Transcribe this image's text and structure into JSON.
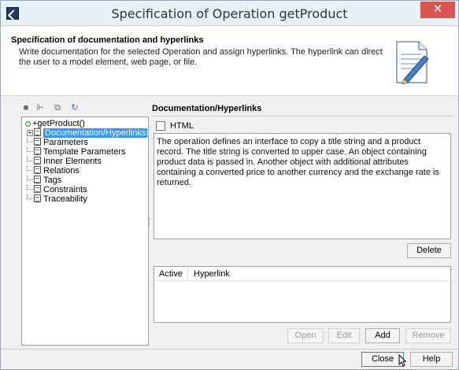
{
  "window": {
    "title": "Specification of Operation getProduct",
    "close_glyph": "✕"
  },
  "header": {
    "title": "Specification of documentation and hyperlinks",
    "description": "Write documentation for the selected Operation and assign hyperlinks. The hyperlink can direct the user to a model element, web page, or file."
  },
  "tree": {
    "root_label": "+getProduct()",
    "items": [
      {
        "label": "Documentation/Hyperlinks",
        "selected": true
      },
      {
        "label": "Parameters"
      },
      {
        "label": "Template Parameters"
      },
      {
        "label": "Inner Elements"
      },
      {
        "label": "Relations"
      },
      {
        "label": "Tags"
      },
      {
        "label": "Constraints"
      },
      {
        "label": "Traceability"
      }
    ]
  },
  "main": {
    "section_title": "Documentation/Hyperlinks",
    "html_checkbox_label": "HTML",
    "documentation_text": "The operation defines an interface to copy a title string and a product record. The title string is converted to upper case. An object containing product data is passed in. Another object with additional attributes containing a converted price to another currency and the exchange rate is returned.",
    "delete_label": "Delete",
    "table": {
      "columns": [
        "Active",
        "Hyperlink"
      ]
    },
    "buttons": {
      "open": "Open",
      "edit": "Edit",
      "add": "Add",
      "remove": "Remove"
    }
  },
  "footer": {
    "close_label": "Close",
    "help_label": "Help"
  },
  "colors": {
    "selection": "#3399ff",
    "close_button": "#d9534f",
    "titlebar": "#e8f0f8"
  },
  "icons": {
    "titlebar": "magicdraw-icon",
    "header": "document-pencil-icon",
    "tree_toolbar": [
      "collapse-icon",
      "tree-view-icon",
      "copy-icon",
      "refresh-icon"
    ]
  }
}
